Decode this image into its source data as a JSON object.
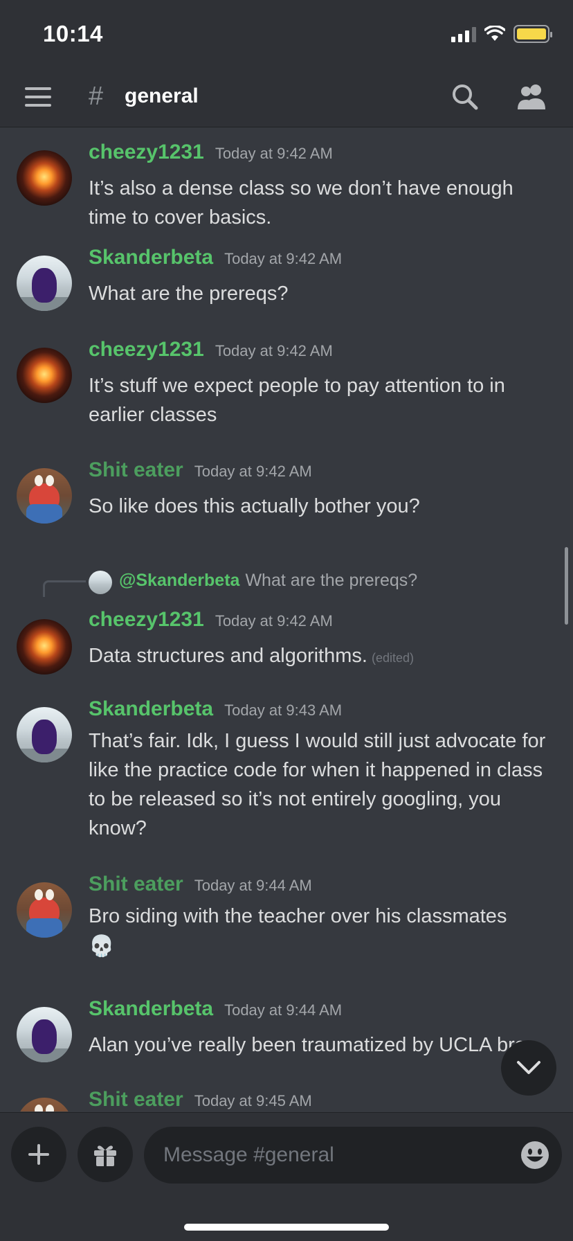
{
  "status_bar": {
    "time": "10:14"
  },
  "header": {
    "hash_symbol": "#",
    "channel_name": "general"
  },
  "messages": [
    {
      "username": "cheezy1231",
      "timestamp": "Today at 9:42 AM",
      "text": "It’s also a dense class so we don’t have enough time to cover basics."
    },
    {
      "username": "Skanderbeta",
      "timestamp": "Today at 9:42 AM",
      "text": "What are the prereqs?"
    },
    {
      "username": "cheezy1231",
      "timestamp": "Today at 9:42 AM",
      "text": "It’s stuff we expect people to pay attention to in earlier classes"
    },
    {
      "username": "Shit eater",
      "timestamp": "Today at 9:42 AM",
      "text": "So like does this actually bother you?"
    },
    {
      "reply_mention": "@Skanderbeta",
      "reply_text": "What are the prereqs?",
      "username": "cheezy1231",
      "timestamp": "Today at 9:42 AM",
      "text": "Data structures and algorithms.",
      "edited_label": "(edited)"
    },
    {
      "username": "Skanderbeta",
      "timestamp": "Today at 9:43 AM",
      "text": "That’s fair. Idk, I guess I would still just advocate for like the practice code for when it happened in class to be released so it’s not entirely googling, you know?"
    },
    {
      "username": "Shit eater",
      "timestamp": "Today at 9:44 AM",
      "text": "Bro siding with the teacher over his classmates",
      "emoji": "💀"
    },
    {
      "username": "Skanderbeta",
      "timestamp": "Today at 9:44 AM",
      "text": "Alan you’ve really been traumatized by UCLA bro"
    },
    {
      "username": "Shit eater",
      "timestamp": "Today at 9:45 AM"
    }
  ],
  "composer": {
    "placeholder": "Message #general"
  },
  "icons": {
    "menu": "hamburger-icon",
    "search": "search-icon",
    "members": "members-icon",
    "add": "plus-icon",
    "gift": "gift-icon",
    "emoji": "emoji-icon",
    "jump": "chevron-down-icon"
  },
  "colors": {
    "background": "#36393f",
    "username_green": "#57c46b",
    "username_dark_green": "#4c9e5e",
    "battery": "#f6d84a"
  }
}
